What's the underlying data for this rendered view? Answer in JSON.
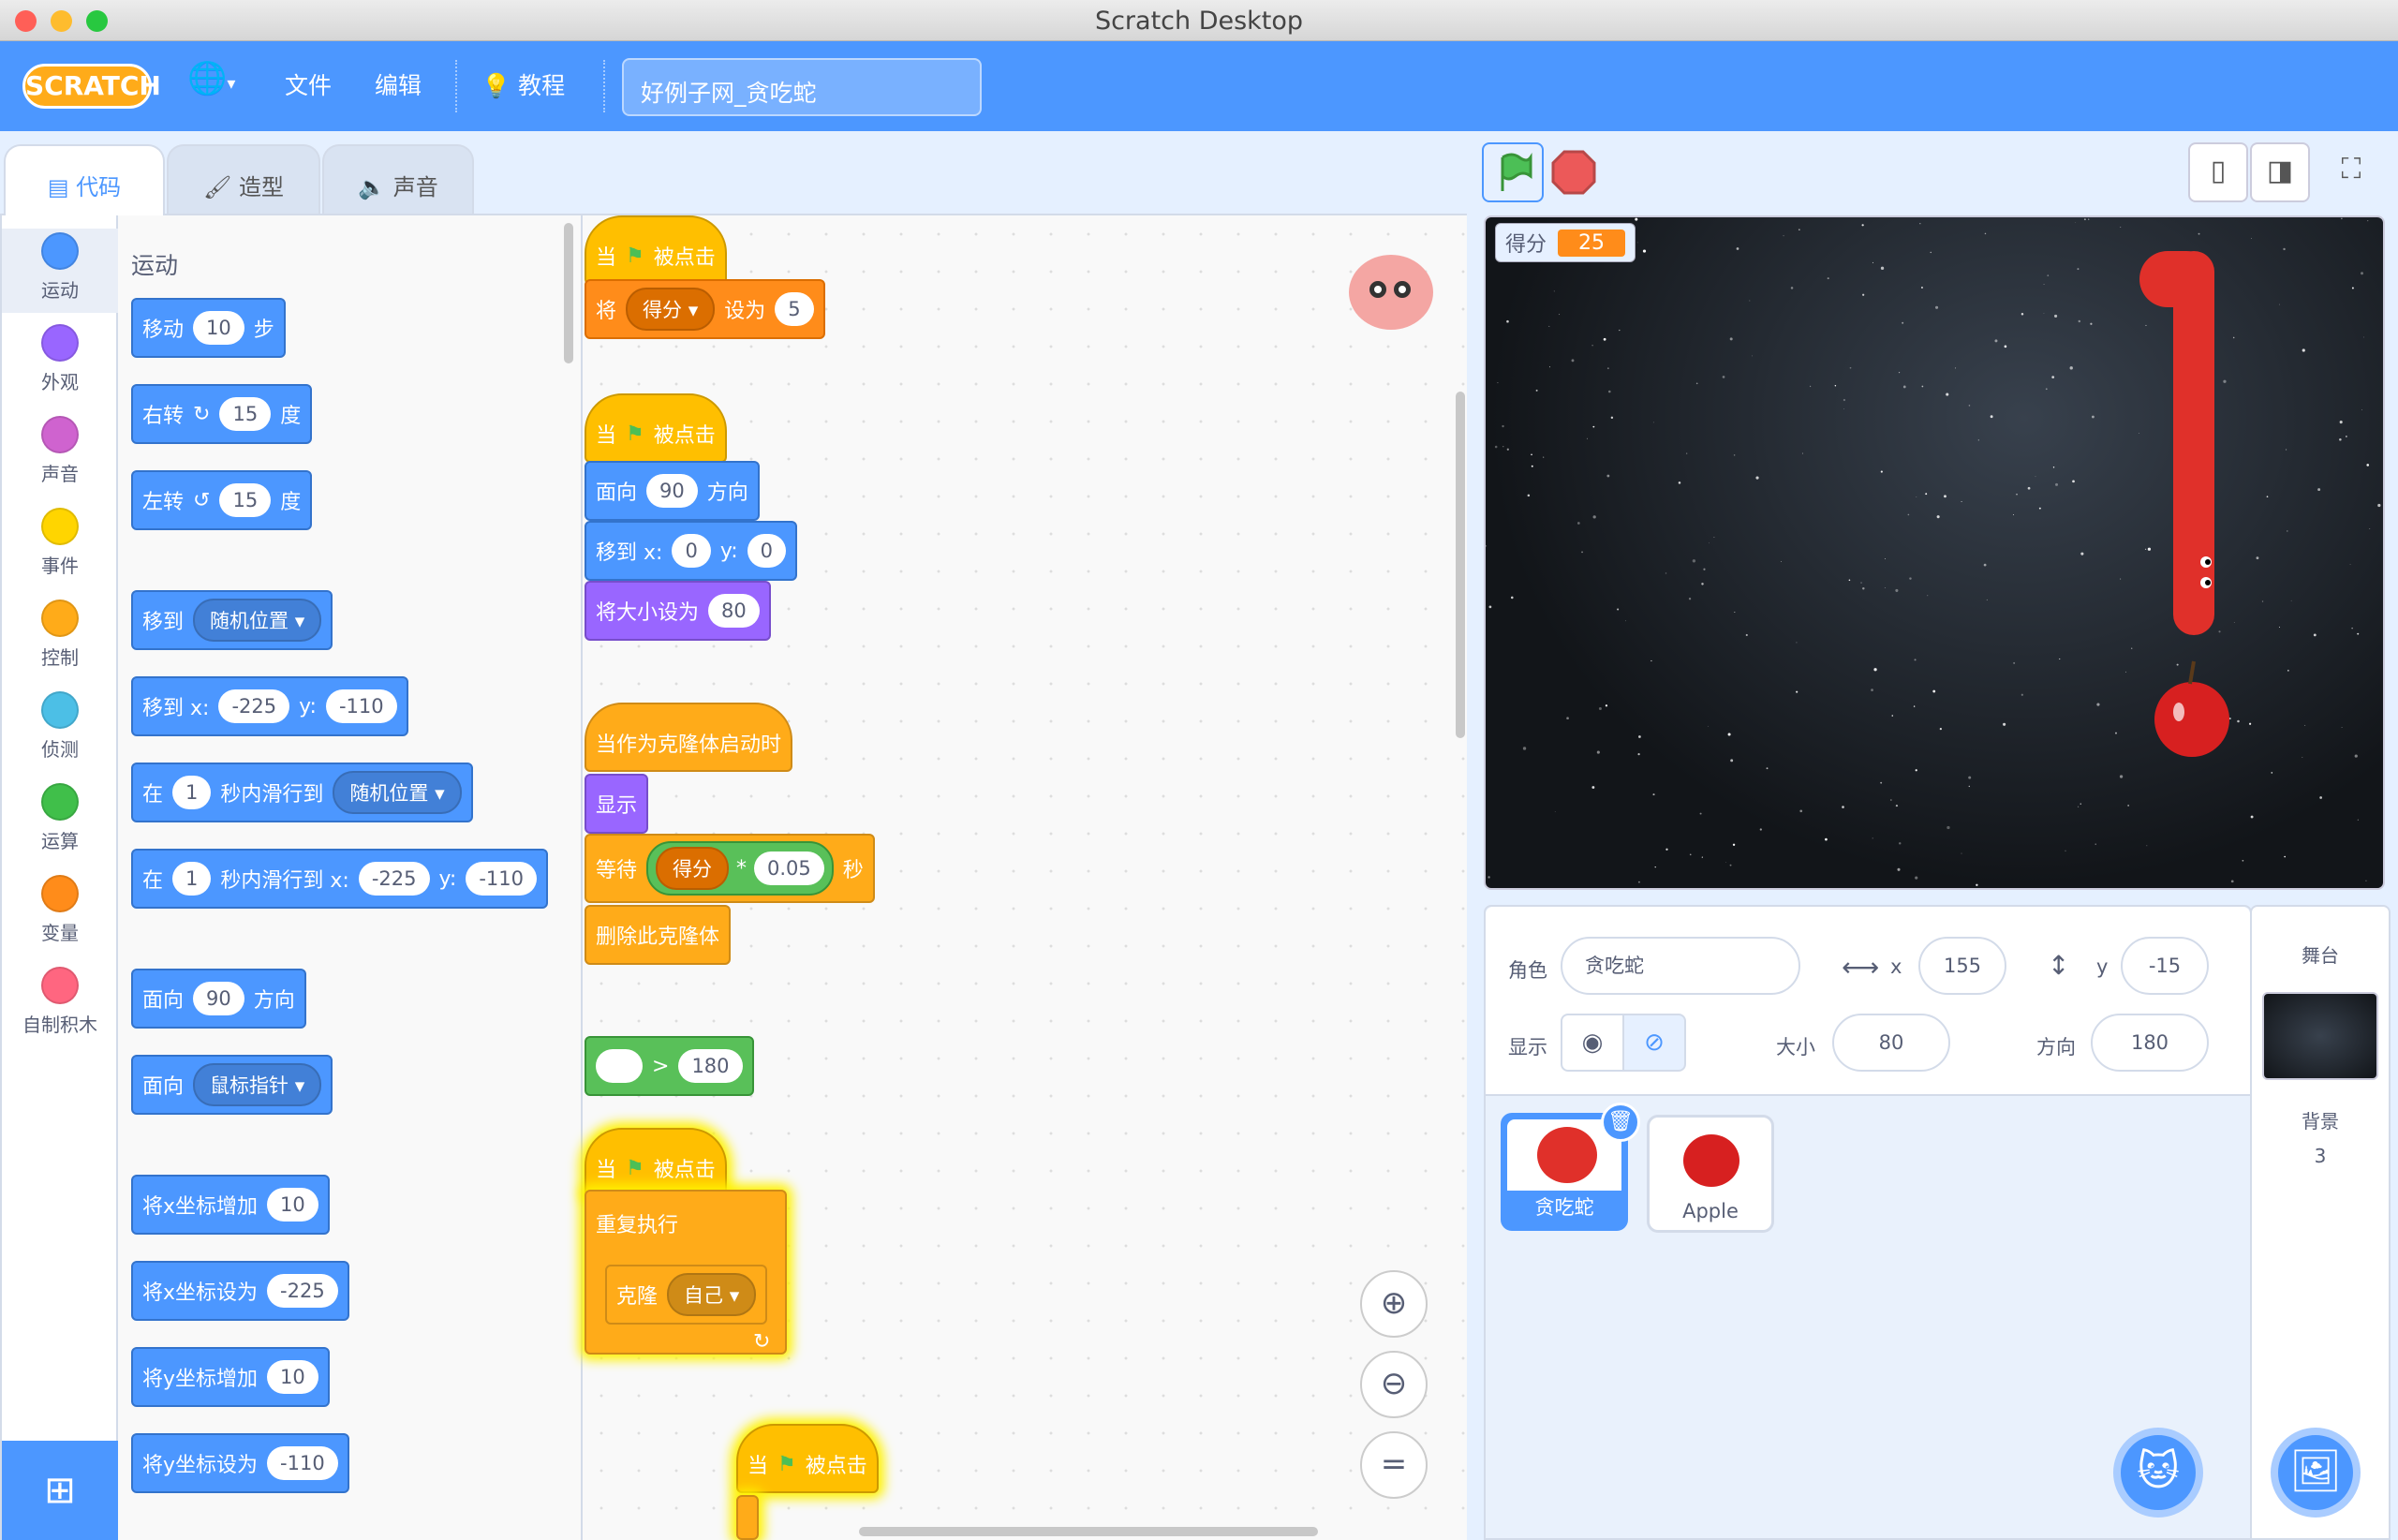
{
  "window": {
    "title": "Scratch Desktop"
  },
  "menu": {
    "file": "文件",
    "edit": "编辑",
    "tutorials": "教程",
    "project_title": "好例子网_贪吃蛇",
    "logo": "SCRATCH"
  },
  "tabs": {
    "code": "代码",
    "costumes": "造型",
    "sounds": "声音"
  },
  "categories": [
    {
      "label": "运动",
      "color": "#4c97ff"
    },
    {
      "label": "外观",
      "color": "#9966ff"
    },
    {
      "label": "声音",
      "color": "#cf63cf"
    },
    {
      "label": "事件",
      "color": "#ffd500"
    },
    {
      "label": "控制",
      "color": "#ffab19"
    },
    {
      "label": "侦测",
      "color": "#4cbfe6"
    },
    {
      "label": "运算",
      "color": "#40bf4a"
    },
    {
      "label": "变量",
      "color": "#ff8c1a"
    },
    {
      "label": "自制积木",
      "color": "#ff6680"
    }
  ],
  "palette": {
    "heading": "运动",
    "move": "移动",
    "move_n": "10",
    "move_unit": "步",
    "turn_right": "右转",
    "turn_left": "左转",
    "deg_val": "15",
    "deg": "度",
    "goto": "移到",
    "random": "随机位置",
    "goto_xy": "移到 x:",
    "y": "y:",
    "xv": "-225",
    "yv": "-110",
    "in": "在",
    "secs": "1",
    "glide_to": "秒内滑行到",
    "glide_xy": "秒内滑行到 x:",
    "point": "面向",
    "dir_val": "90",
    "dir": "方向",
    "mouse": "鼠标指针",
    "change_x": "将x坐标增加",
    "set_x": "将x坐标设为",
    "change_y": "将y坐标增加",
    "set_y": "将y坐标设为",
    "ten": "10"
  },
  "scripts": {
    "when": "当",
    "clicked": "被点击",
    "set": "将",
    "score": "得分",
    "set_to": "设为",
    "five": "5",
    "point": "面向",
    "ninety": "90",
    "dir": "方向",
    "goto_x": "移到 x:",
    "zero": "0",
    "y": "y:",
    "set_size": "将大小设为",
    "eighty": "80",
    "clone_start": "当作为克隆体启动时",
    "show": "显示",
    "wait": "等待",
    "times": "*",
    "factor": "0.05",
    "sec": "秒",
    "delete_clone": "删除此克隆体",
    "gt": ">",
    "n180": "180",
    "forever": "重复执行",
    "clone": "克隆",
    "myself": "自己"
  },
  "stage": {
    "monitor_label": "得分",
    "monitor_value": "25"
  },
  "sprite_info": {
    "sprite_label": "角色",
    "sprite_name": "贪吃蛇",
    "x_label": "x",
    "x": "155",
    "y_label": "y",
    "y": "-15",
    "show_label": "显示",
    "size_label": "大小",
    "size": "80",
    "dir_label": "方向",
    "direction": "180"
  },
  "sprites": [
    {
      "name": "贪吃蛇"
    },
    {
      "name": "Apple"
    }
  ],
  "backdrop": {
    "title": "舞台",
    "label": "背景",
    "count": "3"
  }
}
